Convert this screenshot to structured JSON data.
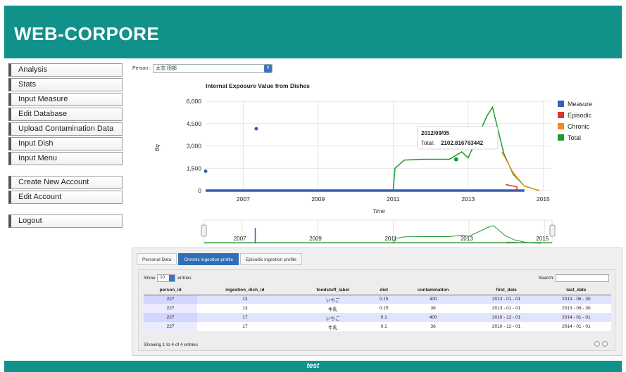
{
  "app": {
    "title": "WEB-CORPORE"
  },
  "sidebar": {
    "group1": [
      {
        "label": "Analysis"
      },
      {
        "label": "Stats"
      },
      {
        "label": "Input Measure"
      },
      {
        "label": "Edit Database"
      },
      {
        "label": "Upload Contamination Data"
      },
      {
        "label": "Input Dish"
      },
      {
        "label": "Input Menu"
      }
    ],
    "group2": [
      {
        "label": "Create New Account"
      },
      {
        "label": "Edit Account"
      }
    ],
    "group3": [
      {
        "label": "Logout"
      }
    ]
  },
  "person": {
    "label": "Person :",
    "value": "太志 田部"
  },
  "chart_data": {
    "type": "line",
    "title": "Internal Exposure Value from Dishes",
    "xlabel": "Time",
    "ylabel": "Bq",
    "ylim": [
      0,
      6000
    ],
    "yticks": [
      "0",
      "1,500",
      "3,000",
      "4,500",
      "6,000"
    ],
    "xticks": [
      "2007",
      "2009",
      "2011",
      "2013",
      "2015"
    ],
    "navigator_ticks": [
      "2007",
      "2009",
      "2011",
      "2013",
      "2015"
    ],
    "legend_position": "right",
    "series": [
      {
        "name": "Measure",
        "color": "#3a5fb0",
        "points": [
          [
            2006.0,
            1300
          ],
          [
            2007.35,
            4150
          ],
          [
            2006.0,
            0
          ],
          [
            2014.5,
            0
          ]
        ]
      },
      {
        "name": "Episodic",
        "color": "#d8362a",
        "points": [
          [
            2014.0,
            400
          ],
          [
            2014.3,
            250
          ],
          [
            2014.3,
            0
          ]
        ]
      },
      {
        "name": "Chronic",
        "color": "#f08c1c",
        "points": [
          [
            2013.9,
            2600
          ],
          [
            2014.2,
            1200
          ],
          [
            2014.5,
            300
          ],
          [
            2014.9,
            0
          ]
        ]
      },
      {
        "name": "Total",
        "color": "#1e9a2e",
        "points": [
          [
            2011.0,
            0
          ],
          [
            2011.05,
            1500
          ],
          [
            2011.3,
            2050
          ],
          [
            2011.8,
            2100
          ],
          [
            2012.5,
            2100
          ],
          [
            2012.83,
            2600
          ],
          [
            2013.0,
            2200
          ],
          [
            2013.5,
            5000
          ],
          [
            2013.65,
            5600
          ],
          [
            2013.95,
            2500
          ],
          [
            2014.2,
            1100
          ],
          [
            2014.5,
            300
          ],
          [
            2014.9,
            0
          ]
        ]
      }
    ],
    "highlight_point": {
      "x": 2012.68,
      "y": 2102.816763442
    },
    "tooltip": {
      "date": "2012/09/05",
      "total_label": "Total:",
      "total_value": "2102.816763442"
    }
  },
  "tabs": [
    {
      "label": "Personal Data"
    },
    {
      "label": "Chronic ingestion profile"
    },
    {
      "label": "Episodic ingestion profile"
    }
  ],
  "table": {
    "show_label": "Show",
    "length_value": "10",
    "entries_label": "entries",
    "search_label": "Search:",
    "columns": [
      "person_id",
      "ingestion_dish_id",
      "foodstuff_label",
      "diet",
      "contamination",
      "first_date",
      "last_date"
    ],
    "rows": [
      [
        "227",
        "13",
        "いちご",
        "0.15",
        "400",
        "2013 - 01 - 01",
        "2013 - 06 - 30"
      ],
      [
        "227",
        "13",
        "牛乳",
        "0.15",
        "36",
        "2013 - 01 - 01",
        "2013 - 06 - 30"
      ],
      [
        "227",
        "17",
        "いちご",
        "0.1",
        "400",
        "2010 - 12 - 01",
        "2014 - 01 - 01"
      ],
      [
        "227",
        "17",
        "牛乳",
        "0.1",
        "36",
        "2010 - 12 - 01",
        "2014 - 01 - 01"
      ]
    ],
    "info": "Showing 1 to 4 of 4 entries"
  },
  "footer": {
    "text": "test"
  },
  "colors": {
    "brand": "#10918a",
    "active_tab": "#2f6fb7"
  }
}
